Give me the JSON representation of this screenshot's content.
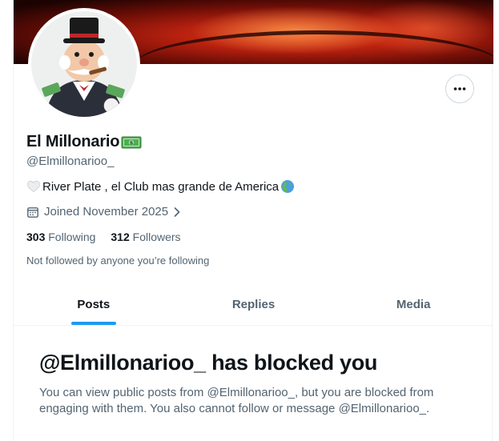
{
  "profile": {
    "display_name": "El Millonario",
    "name_emoji": "money-bill-icon",
    "handle": "@Elmillonarioo_",
    "bio_text": "River Plate , el Club mas grande de America",
    "joined": "Joined November 2025",
    "following_count": "303",
    "following_label": "Following",
    "followers_count": "312",
    "followers_label": "Followers",
    "not_followed": "Not followed by anyone you’re following"
  },
  "tabs": [
    {
      "label": "Posts",
      "active": true
    },
    {
      "label": "Replies",
      "active": false
    },
    {
      "label": "Media",
      "active": false
    }
  ],
  "blocked": {
    "title": "@Elmillonarioo_ has blocked you",
    "description": "You can view public posts from @Elmillonarioo_, but you are blocked from engaging with them. You also cannot follow or message @Elmillonarioo_."
  },
  "colors": {
    "accent": "#1d9bf0",
    "text_primary": "#0f1419",
    "text_secondary": "#536471",
    "border": "#eff3f4"
  },
  "icons": {
    "more": "more-horizontal-icon",
    "calendar": "calendar-icon",
    "chevron": "chevron-right-icon",
    "heart": "white-heart-icon",
    "globe": "globe-americas-icon"
  }
}
